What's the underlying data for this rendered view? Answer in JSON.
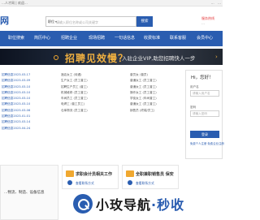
{
  "topbar": {
    "left": "…人才网 | 欢迎…",
    "right_links": [
      "…",
      "…"
    ]
  },
  "header": {
    "logo": "网",
    "search_select": "职位",
    "search_placeholder": "请输入职位名称或公司关键字",
    "search_button": "搜索",
    "hotline_title": "服务热线",
    "hotline_sub": "…"
  },
  "nav": {
    "items": [
      "职位搜索",
      "简历中心",
      "招聘企业",
      "现场招聘",
      "一句话信息",
      "收费标准",
      "联系客服",
      "会员中心"
    ]
  },
  "banner": {
    "headline": "招聘见效慢？",
    "slogan": "入驻企业VIP,助您招聘快人一步"
  },
  "listings": {
    "col1": [
      "招聘信息2023-03-17",
      "招聘信息2023-03-09",
      "招聘信息2023-03-10",
      "招聘信息2023-03-10",
      "招聘信息2023-03-10",
      "招聘信息2023-03-10",
      "招聘信息2023-03-06",
      "招聘信息2023-01-01",
      "招聘信息2023-03-14",
      "招聘信息2023-04-24"
    ],
    "col2": [
      "酒店女工 (待遇)",
      "生产女工 (员工普工)",
      "招聘生产员工 (普工)",
      "机械维修 (员工普工)",
      "车间员工 (员工普工)",
      "电焊工 (普工员工)",
      "仓库物流 (员工普工)"
    ],
    "col3": [
      "普员女 (普员)",
      "普通女工 (员工普工)",
      "普通女工 (员工普工)",
      "操作女工 (员工普工)",
      "学徒女工 (车间普工)",
      "普通女工 (员工普工)",
      "销售员 (终端/员工)"
    ]
  },
  "login": {
    "title": "Hi，您好！",
    "user_label": "用户名",
    "user_placeholder": "请输入用户名",
    "pass_label": "密码",
    "pass_placeholder": "请输入密码",
    "button": "登录",
    "links": "免费个人注册  免费企业注册"
  },
  "bottom": {
    "left_card": "…物流、制造、设备信息",
    "cards": [
      {
        "title": "求职会计员相关工作",
        "sub": "查看联系方式"
      },
      {
        "title": "全职兼职销售员 保安",
        "sub": "查看联系方式"
      }
    ]
  },
  "watermark": {
    "part1": "小玫导航",
    "part2": "·秒收"
  },
  "colors": {
    "brand": "#2a5db0",
    "banner_accent": "#f0b040",
    "warning": "#e4393c"
  }
}
